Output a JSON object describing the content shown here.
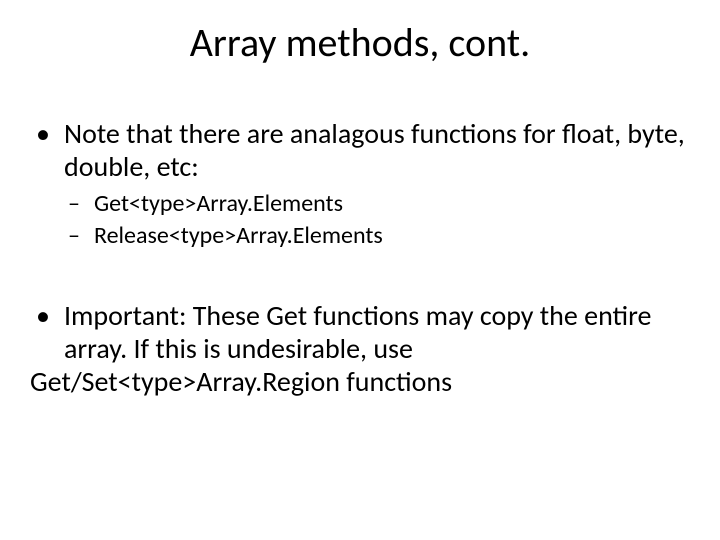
{
  "title": "Array methods, cont.",
  "bullets": {
    "b1": "Note that there are analagous functions for float, byte, double, etc:",
    "b1_sub": {
      "s1": "Get<type>Array.Elements",
      "s2": "Release<type>Array.Elements"
    },
    "b2": "Important: These Get functions may copy the entire array. If this is undesirable, use",
    "b2_cont": " Get/Set<type>Array.Region functions"
  }
}
